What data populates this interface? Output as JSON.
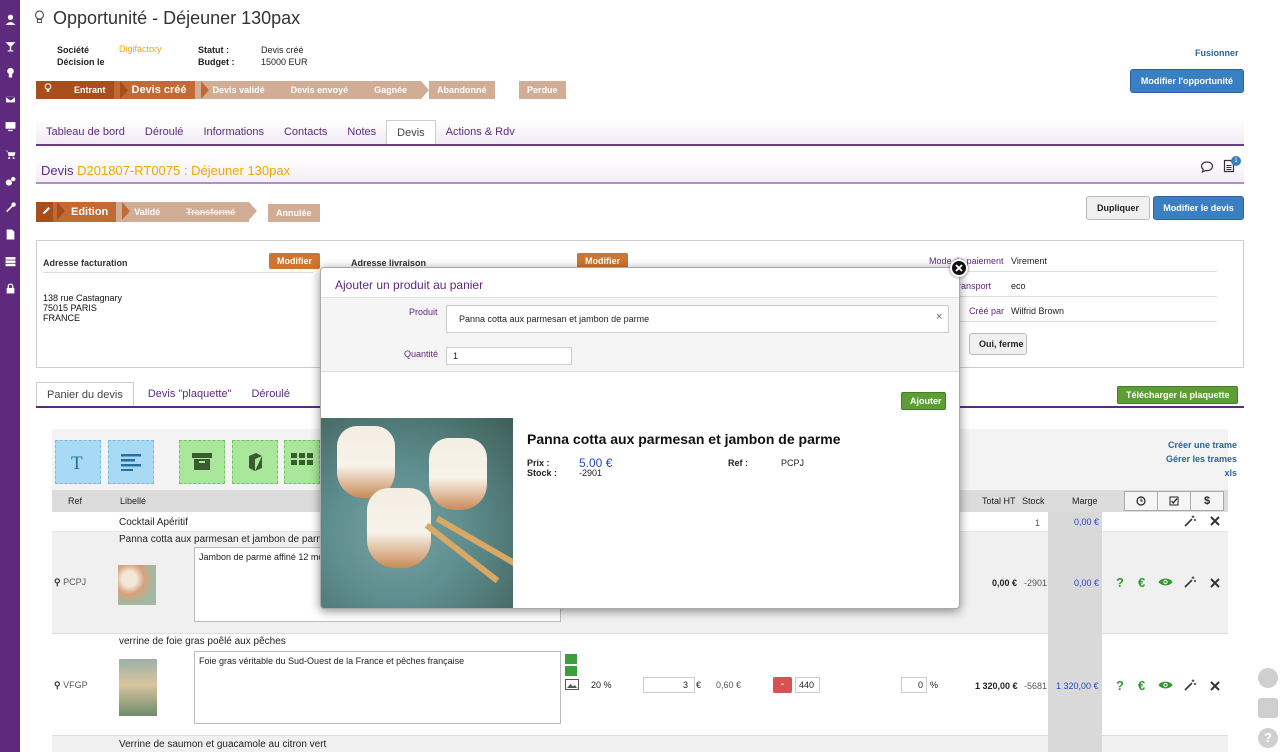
{
  "header": {
    "title": "Opportunité - Déjeuner 130pax",
    "societe_label": "Société",
    "societe_value": "Digifactory",
    "decision_label": "Décision le",
    "statut_label": "Statut :",
    "statut_value": "Devis créé",
    "budget_label": "Budget :",
    "budget_value": "15000 EUR",
    "fusionner": "Fusionner",
    "modifier_opportunite": "Modifier l'opportunité"
  },
  "pipeline": {
    "steps": [
      "Entrant",
      "Devis créé",
      "Devis validé",
      "Devis envoyé",
      "Gagnée"
    ],
    "abandonne": "Abandonné",
    "perdue": "Perdue"
  },
  "tabs": [
    "Tableau de bord",
    "Déroulé",
    "Informations",
    "Contacts",
    "Notes",
    "Devis",
    "Actions & Rdv"
  ],
  "devis": {
    "label": "Devis",
    "ref": "D201807-RT0075 : Déjeuner 130pax",
    "badge": "1",
    "steps": [
      "Edition",
      "Validé",
      "Transformé"
    ],
    "annulee": "Annulée",
    "dupliquer": "Dupliquer",
    "modifier_devis": "Modifier le devis"
  },
  "address": {
    "facturation_label": "Adresse facturation",
    "livraison_label": "Adresse livraison",
    "modifier": "Modifier",
    "line1": "138 rue Castagnary",
    "line2": "75015 PARIS",
    "line3": "FRANCE",
    "mode_paiement_label": "Mode de paiement",
    "mode_paiement_value": "Virement",
    "transport_label": "Mode de transport",
    "transport_value": "eco",
    "cree_par_label": "Créé par",
    "cree_par_value": "Wilfrid Brown",
    "oui_ferme": "Oui, ferme"
  },
  "panier_tabs": [
    "Panier du devis",
    "Devis \"plaquette\"",
    "Déroulé"
  ],
  "telecharger": "Télécharger la plaquette",
  "trame": {
    "creer": "Créer une trame",
    "gerer": "Gérer les trames",
    "xls": "xls"
  },
  "table": {
    "headers": {
      "ref": "Ref",
      "libelle": "Libellé",
      "total_ht": "Total HT",
      "stock": "Stock",
      "marge": "Marge"
    },
    "rows": [
      {
        "title": "Cocktail Apéritif",
        "stock": "1",
        "marge": "0,00 €"
      },
      {
        "title": "Panna cotta aux parmesan et jambon de parme",
        "ref": "PCPJ",
        "desc": "Jambon de parme affiné 12 mois",
        "total": "0,00 €",
        "stock": "-2901",
        "marge": "0,00 €"
      },
      {
        "title": "verrine de foie gras poêlé aux pêches",
        "ref": "VFGP",
        "desc": "Foie gras véritable du Sud-Ouest de la France et pêches française",
        "pct": "20 %",
        "qty": "3",
        "cur": "€",
        "price": "0,60 €",
        "minus": "-",
        "num": "440",
        "discount": "0",
        "discount_unit": "%",
        "total": "1 320,00 €",
        "stock": "-5681",
        "marge": "1 320,00 €"
      },
      {
        "title": "Verrine de saumon et guacamole au citron vert"
      }
    ],
    "action_help": "?",
    "action_euro": "€"
  },
  "modal": {
    "title": "Ajouter un produit au panier",
    "produit_label": "Produit",
    "produit_value": "Panna cotta aux parmesan et jambon de parme",
    "clear": "×",
    "quantite_label": "Quantité",
    "quantite_value": "1",
    "ajouter": "Ajouter",
    "product_name": "Panna cotta aux parmesan et jambon de parme",
    "prix_label": "Prix :",
    "prix_value": "5.00 €",
    "stock_label": "Stock :",
    "stock_value": "-2901",
    "ref_label": "Ref :",
    "ref_value": "PCPJ"
  },
  "colors": {
    "sidebar": "#5e2a7e",
    "accent": "#c26a35",
    "blue": "#3a7fc1",
    "green": "#5a9e35"
  }
}
